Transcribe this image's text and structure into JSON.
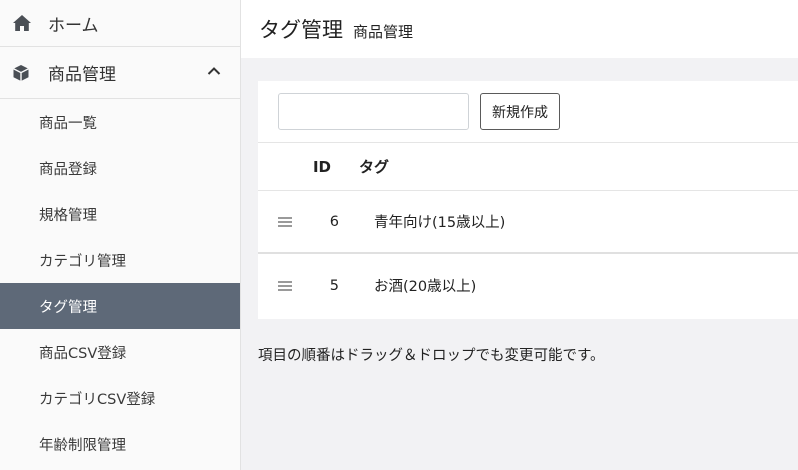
{
  "sidebar": {
    "home_label": "ホーム",
    "product_group_label": "商品管理",
    "items": [
      {
        "label": "商品一覧",
        "active": false
      },
      {
        "label": "商品登録",
        "active": false
      },
      {
        "label": "規格管理",
        "active": false
      },
      {
        "label": "カテゴリ管理",
        "active": false
      },
      {
        "label": "タグ管理",
        "active": true
      },
      {
        "label": "商品CSV登録",
        "active": false
      },
      {
        "label": "カテゴリCSV登録",
        "active": false
      },
      {
        "label": "年齢制限管理",
        "active": false
      }
    ]
  },
  "header": {
    "title": "タグ管理",
    "subtitle": "商品管理"
  },
  "toolbar": {
    "search_value": "",
    "new_button_label": "新規作成"
  },
  "table": {
    "columns": [
      "ID",
      "タグ"
    ],
    "rows": [
      {
        "id": "6",
        "name": "青年向け(15歳以上)"
      },
      {
        "id": "5",
        "name": "お酒(20歳以上)"
      }
    ]
  },
  "hint_text": "項目の順番はドラッグ＆ドロップでも変更可能です。",
  "colors": {
    "active_bg": "#5e6978",
    "page_bg": "#f2f2f4"
  }
}
